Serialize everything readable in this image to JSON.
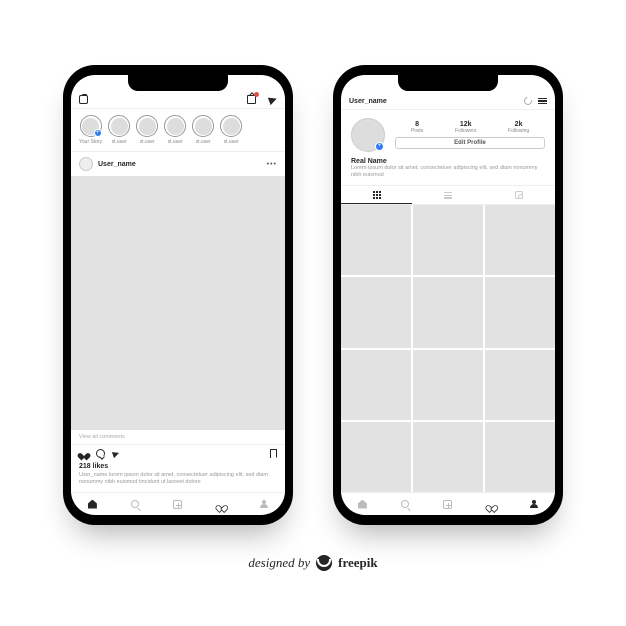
{
  "feed": {
    "stories": [
      {
        "label": "Your Story",
        "add": true
      },
      {
        "label": "st.user"
      },
      {
        "label": "st.user"
      },
      {
        "label": "st.user"
      },
      {
        "label": "st.user"
      },
      {
        "label": "st.user"
      }
    ],
    "post": {
      "username": "User_name",
      "view_comments": "View all comments",
      "likes": "218 likes",
      "caption": "User_name lorem ipsum dolor sit amet, consectetuer adipiscing elit, sed diam nonummy nibh euismod tincidunt ut laoreet dolore"
    }
  },
  "profile": {
    "username": "User_name",
    "stats": {
      "posts_n": "8",
      "posts_l": "Posts",
      "followers_n": "12k",
      "followers_l": "Followers",
      "following_n": "2k",
      "following_l": "Following"
    },
    "edit_label": "Edit Profile",
    "real_name": "Real Name",
    "bio": "Lorem ipsum dolor sit amet, consectetuer adipiscing elit, sed diam nonummy nibh euismod"
  },
  "credit": {
    "pre": "designed by",
    "brand": "freepik"
  }
}
